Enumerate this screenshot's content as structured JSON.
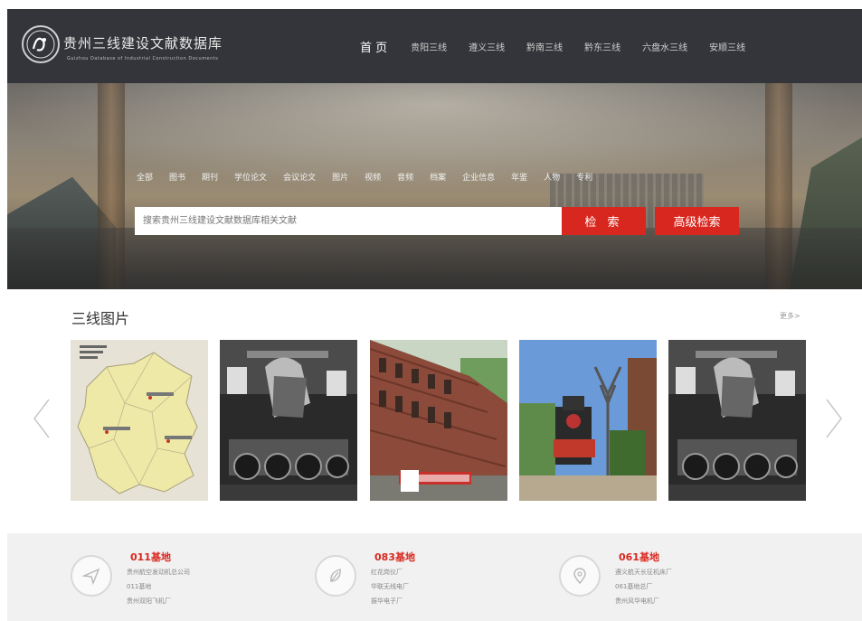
{
  "header": {
    "title": "贵州三线建设文献数据库",
    "subtitle": "Guizhou Database of Industrial Construction Documents",
    "nav": [
      "首 页",
      "贵阳三线",
      "遵义三线",
      "黔南三线",
      "黔东三线",
      "六盘水三线",
      "安顺三线"
    ]
  },
  "search": {
    "categories": [
      "全部",
      "图书",
      "期刊",
      "学位论文",
      "会议论文",
      "图片",
      "视频",
      "音频",
      "档案",
      "企业信息",
      "年鉴",
      "人物",
      "专利"
    ],
    "placeholder": "搜索贵州三线建设文献数据库相关文献",
    "search_label": "检 索",
    "advanced_label": "高级检索"
  },
  "pictures": {
    "title": "三线图片",
    "more": "更多>",
    "items": [
      "map",
      "locomotive-bw",
      "brick-factory",
      "red-locomotive",
      "locomotive-bw-2"
    ]
  },
  "bases": [
    {
      "title": "011基地",
      "icon": "send-icon",
      "items": [
        "贵州航空发动机总公司",
        "011基地",
        "贵州双阳飞机厂"
      ]
    },
    {
      "title": "083基地",
      "icon": "leaf-icon",
      "items": [
        "红花岗仪厂",
        "华联无线电厂",
        "振华电子厂"
      ]
    },
    {
      "title": "061基地",
      "icon": "location-pin-icon",
      "items": [
        "遵义航天长征机床厂",
        "061基地总厂",
        "贵州风华电机厂"
      ]
    }
  ],
  "colors": {
    "accent": "#d8271e",
    "header_bg": "#33353a"
  }
}
